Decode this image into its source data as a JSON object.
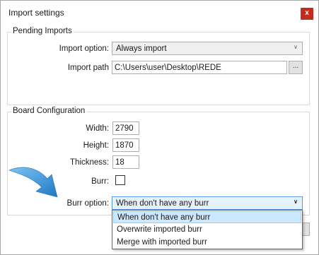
{
  "window": {
    "title": "Import settings",
    "close_glyph": "x"
  },
  "pending_imports": {
    "title": "Pending Imports",
    "import_option_label": "Import option:",
    "import_option_value": "Always import",
    "import_path_label": "Import path",
    "import_path_value": "C:\\Users\\user\\Desktop\\REDE",
    "browse_label": "..."
  },
  "board_configuration": {
    "title": "Board Configuration",
    "width_label": "Width:",
    "width_value": "2790",
    "height_label": "Height:",
    "height_value": "1870",
    "thickness_label": "Thickness:",
    "thickness_value": "18",
    "burr_label": "Burr:",
    "burr_checked": false,
    "burr_option_label": "Burr option:",
    "burr_option_value": "When don't have any burr",
    "burr_option_items": [
      "When don't have any burr",
      "Overwrite imported burr",
      "Merge with imported burr"
    ]
  },
  "colors": {
    "accent": "#569de5",
    "close": "#c42b1c",
    "arrow": "#2b8fd6"
  },
  "icons": {
    "close": "close-icon",
    "chevron": "chevron-down-icon",
    "arrow": "blue-arrow-icon"
  }
}
